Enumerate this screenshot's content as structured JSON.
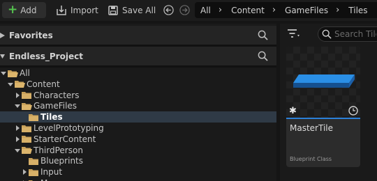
{
  "toolbar": {
    "add_label": "Add",
    "import_label": "Import",
    "save_all_label": "Save All",
    "icons": [
      "plus-icon",
      "import-icon",
      "save-icon",
      "back-arrow-icon",
      "forward-arrow-icon"
    ]
  },
  "breadcrumb": [
    "All",
    "Content",
    "GameFiles",
    "Tiles"
  ],
  "sections": {
    "favorites": "Favorites",
    "project": "Endless_Project"
  },
  "tree": [
    {
      "label": "All",
      "expanded": true,
      "depth": 0
    },
    {
      "label": "Content",
      "expanded": true,
      "depth": 1
    },
    {
      "label": "Characters",
      "expanded": false,
      "depth": 2
    },
    {
      "label": "GameFiles",
      "expanded": true,
      "depth": 2
    },
    {
      "label": "Tiles",
      "expanded": false,
      "depth": 3,
      "selected": true
    },
    {
      "label": "LevelPrototyping",
      "expanded": false,
      "depth": 2
    },
    {
      "label": "StarterContent",
      "expanded": false,
      "depth": 2
    },
    {
      "label": "ThirdPerson",
      "expanded": true,
      "depth": 2
    },
    {
      "label": "Blueprints",
      "expanded": false,
      "depth": 3
    },
    {
      "label": "Input",
      "expanded": false,
      "depth": 3
    },
    {
      "label": "Ma",
      "expanded": false,
      "depth": 3
    }
  ],
  "search": {
    "placeholder": "Search Tiles"
  },
  "asset": {
    "name": "MasterTile",
    "type": "Blueprint Class"
  },
  "colors": {
    "accent": "#2b80d8",
    "add_plus": "#55c24f",
    "folder": "#c9a15a",
    "selected_row": "#2f3a46"
  }
}
